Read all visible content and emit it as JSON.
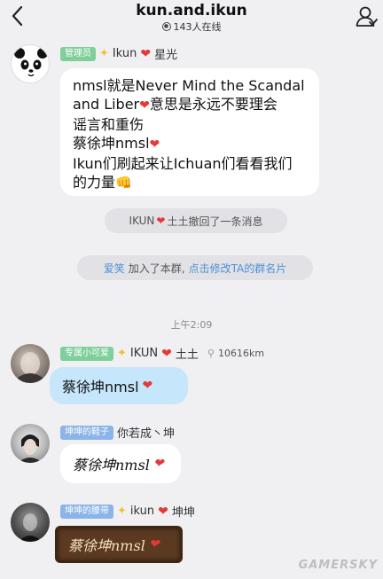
{
  "header": {
    "title": "kun.and.ikun",
    "online_count": "143人在线"
  },
  "messages": [
    {
      "badge": "管理员",
      "name_prefix": "Ikun",
      "name_suffix": "星光",
      "lines": [
        "nmsl就是Never Mind the Scandal",
        "and Liber",
        "意思是永远不要理会",
        "谣言和重伤",
        "蔡徐坤nmsl",
        "Ikun们刷起来让Ichuan们看看我们",
        "的力量"
      ]
    },
    {
      "badge": "专属小可爱",
      "name_prefix": "IKUN",
      "name_suffix": "土土",
      "distance": "10616km",
      "text": "蔡徐坤nmsl"
    },
    {
      "badge": "坤坤的鞋子",
      "name": "你若成丶坤",
      "text": "蔡徐坤nmsl"
    },
    {
      "badge": "坤坤的腰带",
      "name_prefix": "ikun",
      "name_suffix": "坤坤",
      "text": "蔡徐坤nmsl"
    }
  ],
  "system": {
    "recall_name": "IKUN",
    "recall_text": "土土撤回了一条消息",
    "join_name": "爱笑",
    "join_text": "加入了本群,",
    "join_link": "点击修改TA的群名片"
  },
  "time_separator": "上午2:09",
  "watermark": "GAMERSKY",
  "colors": {
    "background": "#f0f0f3",
    "bubble_blue": "#c6e6fb",
    "badge_green": "#7ecf9a",
    "badge_blue": "#8bb4e8",
    "link": "#4d8fd6",
    "heart": "#e53935"
  },
  "icons": {
    "back": "chevron-left-icon",
    "members": "person-icon",
    "star": "star-icon",
    "heart": "heart-icon",
    "location": "location-pin-icon",
    "fist": "fist-icon"
  }
}
